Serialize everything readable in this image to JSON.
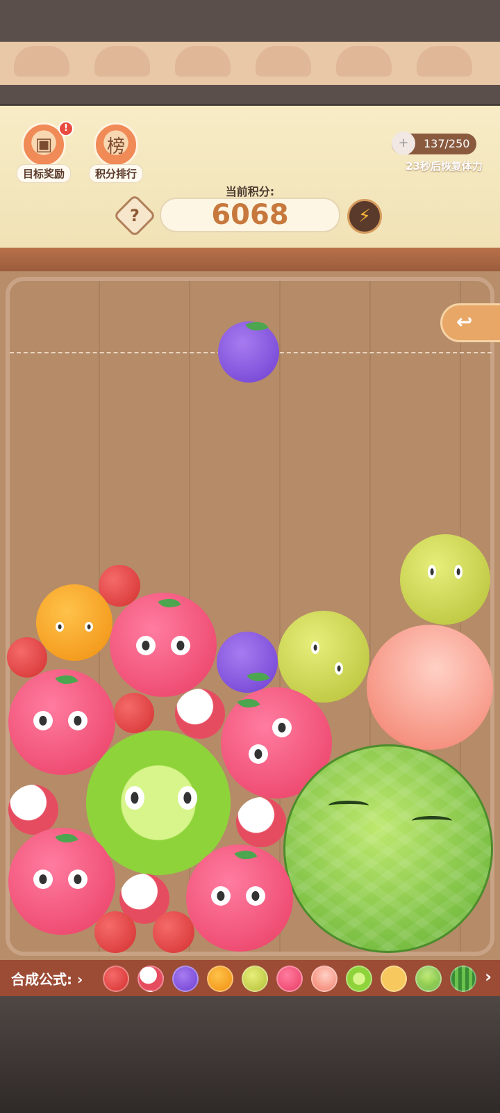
{
  "header": {
    "buttons": [
      {
        "label": "目标奖励",
        "icon": "treasure-chest-icon",
        "has_alert": true,
        "alert_text": "!"
      },
      {
        "label": "积分排行",
        "icon": "ranking-scroll-icon",
        "scroll_text": "榜"
      }
    ],
    "stamina": {
      "value": "137/250",
      "recover_text": "23秒后恢复体力"
    },
    "score": {
      "label": "当前积分:",
      "value": "6068"
    },
    "help_label": "?",
    "boost_label": "⚡"
  },
  "formula": {
    "label": "合成公式:",
    "arrow": "›",
    "next": "›",
    "fruits": [
      "cherry",
      "lychee",
      "grape",
      "orange",
      "lemon",
      "apple",
      "peach",
      "kiwi",
      "pineapple",
      "melon",
      "watermelon"
    ]
  },
  "back_label": "↩"
}
